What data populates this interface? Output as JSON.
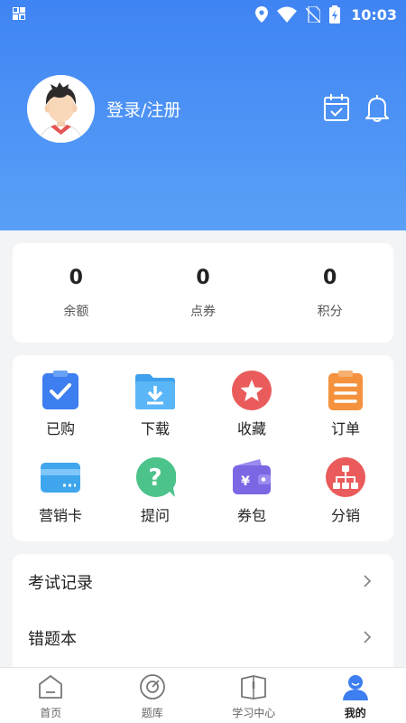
{
  "status_bar": {
    "time": "10:03"
  },
  "profile": {
    "login_label": "登录/注册"
  },
  "stats": [
    {
      "value": "0",
      "label": "余额"
    },
    {
      "value": "0",
      "label": "点券"
    },
    {
      "value": "0",
      "label": "积分"
    }
  ],
  "grid": [
    {
      "label": "已购",
      "icon": "clipboard-check-icon"
    },
    {
      "label": "下载",
      "icon": "folder-download-icon"
    },
    {
      "label": "收藏",
      "icon": "star-icon"
    },
    {
      "label": "订单",
      "icon": "order-list-icon"
    },
    {
      "label": "营销卡",
      "icon": "card-icon"
    },
    {
      "label": "提问",
      "icon": "question-icon"
    },
    {
      "label": "券包",
      "icon": "wallet-icon"
    },
    {
      "label": "分销",
      "icon": "distribution-icon"
    }
  ],
  "list": [
    {
      "label": "考试记录"
    },
    {
      "label": "错题本"
    }
  ],
  "tabs": [
    {
      "label": "首页"
    },
    {
      "label": "题库"
    },
    {
      "label": "学习中心"
    },
    {
      "label": "我的"
    }
  ],
  "colors": {
    "header_blue": "#3f84f3",
    "accent": "#3d7ef0"
  }
}
